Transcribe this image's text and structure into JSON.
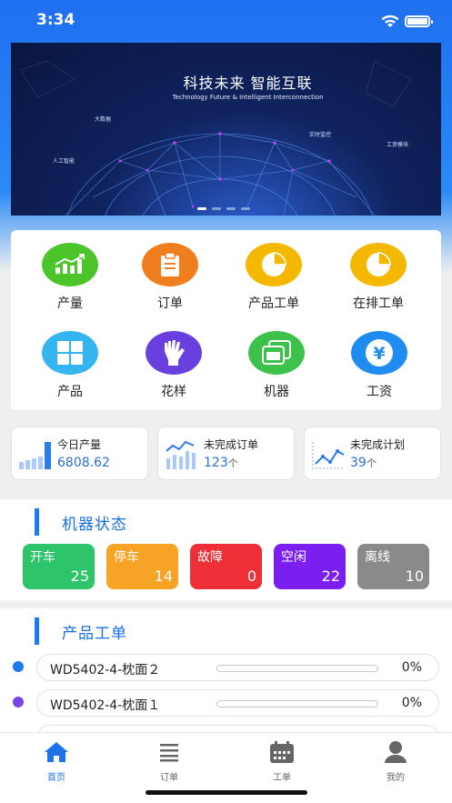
{
  "status_bar": {
    "time": "3:34"
  },
  "banner": {
    "title": "科技未来 智能互联",
    "subtitle": "Technology Future & Intelligent Interconnection",
    "labels": [
      "大数据",
      "实时监控",
      "工资模块",
      "人工智能"
    ]
  },
  "menu": {
    "items": [
      {
        "label": "产量",
        "icon": "bar-chart-icon",
        "color": "#4cc52a"
      },
      {
        "label": "订单",
        "icon": "clipboard-icon",
        "color": "#f07d1e"
      },
      {
        "label": "产品工单",
        "icon": "pie-chart-icon",
        "color": "#f5b800"
      },
      {
        "label": "在排工单",
        "icon": "pie-chart-icon",
        "color": "#f5b800"
      },
      {
        "label": "产品",
        "icon": "grid-icon",
        "color": "#34b5ef"
      },
      {
        "label": "花样",
        "icon": "glove-icon",
        "color": "#6a3fe0"
      },
      {
        "label": "机器",
        "icon": "window-icon",
        "color": "#3cc24a"
      },
      {
        "label": "工资",
        "icon": "yen-icon",
        "color": "#1e8cf0"
      }
    ]
  },
  "stats": [
    {
      "title": "今日产量",
      "value": "6808.62",
      "unit": ""
    },
    {
      "title": "未完成订单",
      "value": "123",
      "unit": "个"
    },
    {
      "title": "未完成计划",
      "value": "39",
      "unit": "个"
    }
  ],
  "machine_status": {
    "title": "机器状态",
    "items": [
      {
        "label": "开车",
        "count": "25",
        "color": "#2dc46a"
      },
      {
        "label": "停车",
        "count": "14",
        "color": "#f7a325"
      },
      {
        "label": "故障",
        "count": "0",
        "color": "#ef2f37"
      },
      {
        "label": "空闲",
        "count": "22",
        "color": "#7a1ff0"
      },
      {
        "label": "离线",
        "count": "10",
        "color": "#8a8a8a"
      }
    ]
  },
  "product_orders": {
    "title": "产品工单",
    "items": [
      {
        "name": "WD5402-4-枕面２",
        "progress_pct": 0,
        "percent": "0%",
        "dot_color": "#1a7af0"
      },
      {
        "name": "WD5402-4-枕面１",
        "progress_pct": 0,
        "percent": "0%",
        "dot_color": "#7a45e8"
      }
    ]
  },
  "tab_bar": {
    "tabs": [
      {
        "label": "首页",
        "icon": "home-icon",
        "active": true
      },
      {
        "label": "订单",
        "icon": "list-icon",
        "active": false
      },
      {
        "label": "工单",
        "icon": "calendar-icon",
        "active": false
      },
      {
        "label": "我的",
        "icon": "user-icon",
        "active": false
      }
    ]
  }
}
